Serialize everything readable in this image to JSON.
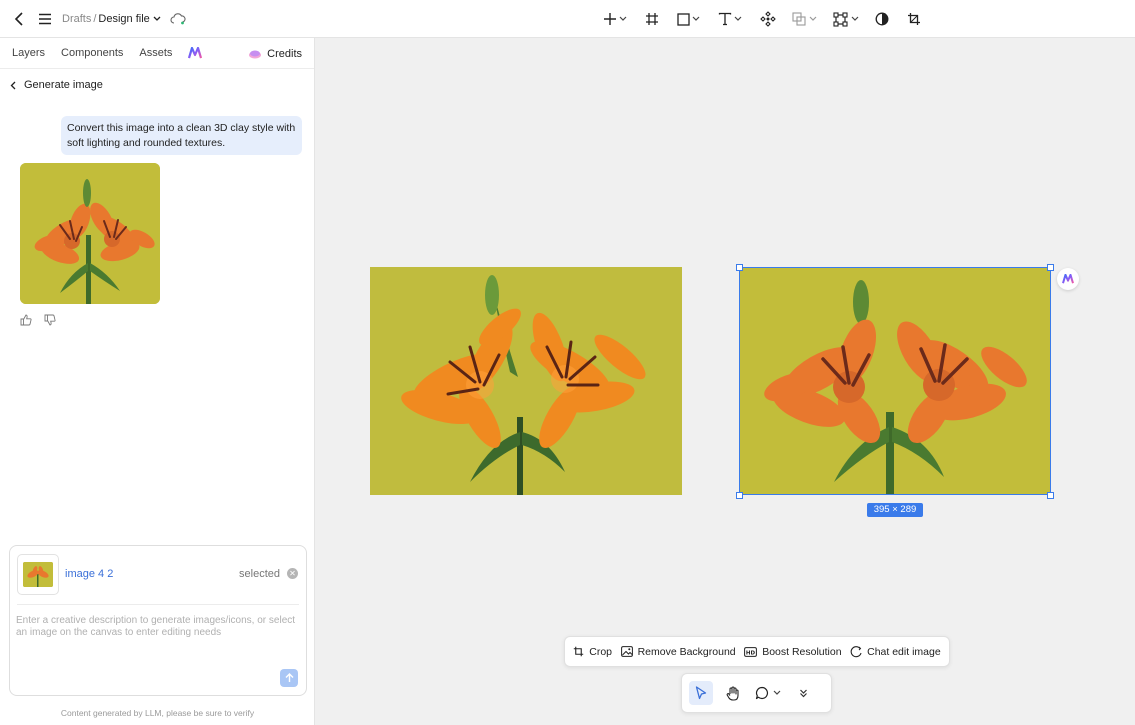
{
  "header": {
    "crumb_drafts": "Drafts",
    "crumb_sep": "/",
    "file_name": "Design file",
    "tools": [
      "add-icon",
      "frame-icon",
      "rectangle-icon",
      "text-icon",
      "component-icon",
      "boolean-icon",
      "mask-icon",
      "contrast-icon",
      "crop-icon"
    ]
  },
  "sidebar": {
    "tabs": [
      {
        "label": "Layers"
      },
      {
        "label": "Components"
      },
      {
        "label": "Assets"
      }
    ],
    "credits_label": "Credits",
    "back_label": "Generate image"
  },
  "chat": {
    "user_message": "Convert this image into a clean 3D clay style with soft lighting and rounded textures."
  },
  "composer": {
    "selected_name": "image 4 2",
    "selected_status": "selected",
    "placeholder": "Enter a creative description to generate images/icons, or select an image on the canvas to enter editing needs",
    "disclaimer": "Content generated by LLM, please be sure to verify"
  },
  "canvas": {
    "selection_size": "395 × 289"
  },
  "action_bar": {
    "crop": "Crop",
    "remove_bg": "Remove Background",
    "boost": "Boost Resolution",
    "chat_edit": "Chat edit image"
  },
  "colors": {
    "accent": "#3a7bea",
    "image_bg": "#c1bd3c",
    "bubble_bg": "#e6eefc"
  }
}
